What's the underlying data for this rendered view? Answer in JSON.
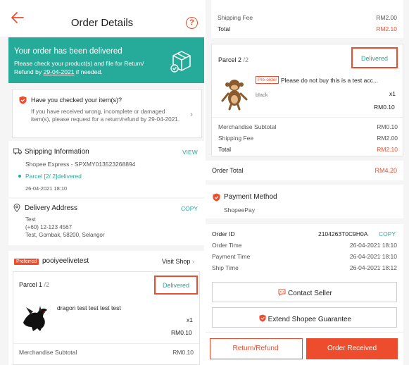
{
  "left": {
    "header": {
      "title": "Order Details",
      "help_glyph": "?"
    },
    "banner": {
      "title": "Your order has been delivered",
      "text_pre": "Please check your product(s) and file for Return/ Refund by ",
      "text_date": "29-04-2021",
      "text_post": " if needed."
    },
    "check": {
      "title": "Have you checked your item(s)?",
      "body": "If you have received wrong, incomplete or damaged item(s), please request for a return/refund by 29-04-2021."
    },
    "shipping": {
      "title": "Shipping Information",
      "view": "VIEW",
      "courier": "Shopee Express - SPXMY013523268894",
      "parcel_status": "Parcel [2/ 2]delivered",
      "timestamp": "26-04-2021 18:10"
    },
    "address": {
      "title": "Delivery Address",
      "copy": "COPY",
      "name": "Test",
      "phone": "(+60) 12-123 4567",
      "location": "Test, Gombak, 58200, Selangor"
    },
    "shop": {
      "badge": "Preferred",
      "name": "pooiyeelivetest",
      "visit": "Visit Shop"
    },
    "parcel": {
      "title": "Parcel 1",
      "count": " /2",
      "status": "Delivered",
      "product": "dragon test test test test",
      "qty": "x1",
      "price": "RM0.10",
      "subtotal_label": "Merchandise Subtotal",
      "subtotal_value": "RM0.10"
    }
  },
  "right": {
    "top": {
      "shipping_label": "Shipping Fee",
      "shipping_value": "RM2.00",
      "total_label": "Total",
      "total_value": "RM2.10"
    },
    "parcel": {
      "title": "Parcel 2",
      "count": " /2",
      "status": "Delivered",
      "preorder": "Pre-order",
      "product": "Please do not buy this is a test acc...",
      "variation": "black",
      "qty": "x1",
      "price": "RM0.10",
      "subtotal_label": "Merchandise Subtotal",
      "subtotal_value": "RM0.10",
      "shipping_label": "Shipping Fee",
      "shipping_value": "RM2.00",
      "total_label": "Total",
      "total_value": "RM2.10"
    },
    "order_total": {
      "label": "Order Total",
      "value": "RM4.20"
    },
    "payment": {
      "title": "Payment Method",
      "method": "ShopeePay"
    },
    "order": {
      "id_label": "Order ID",
      "id_value": "2104263T0C9H0A",
      "copy": "COPY",
      "time_label": "Order Time",
      "time_value": "26-04-2021 18:10",
      "pay_label": "Payment Time",
      "pay_value": "26-04-2021 18:10",
      "ship_label": "Ship Time",
      "ship_value": "26-04-2021 18:12"
    },
    "buttons": {
      "contact": "Contact Seller",
      "guarantee": "Extend Shopee Guarantee",
      "return": "Return/Refund",
      "received": "Order Received"
    }
  },
  "colors": {
    "accent": "#ee4d2d",
    "teal": "#26aa99"
  }
}
